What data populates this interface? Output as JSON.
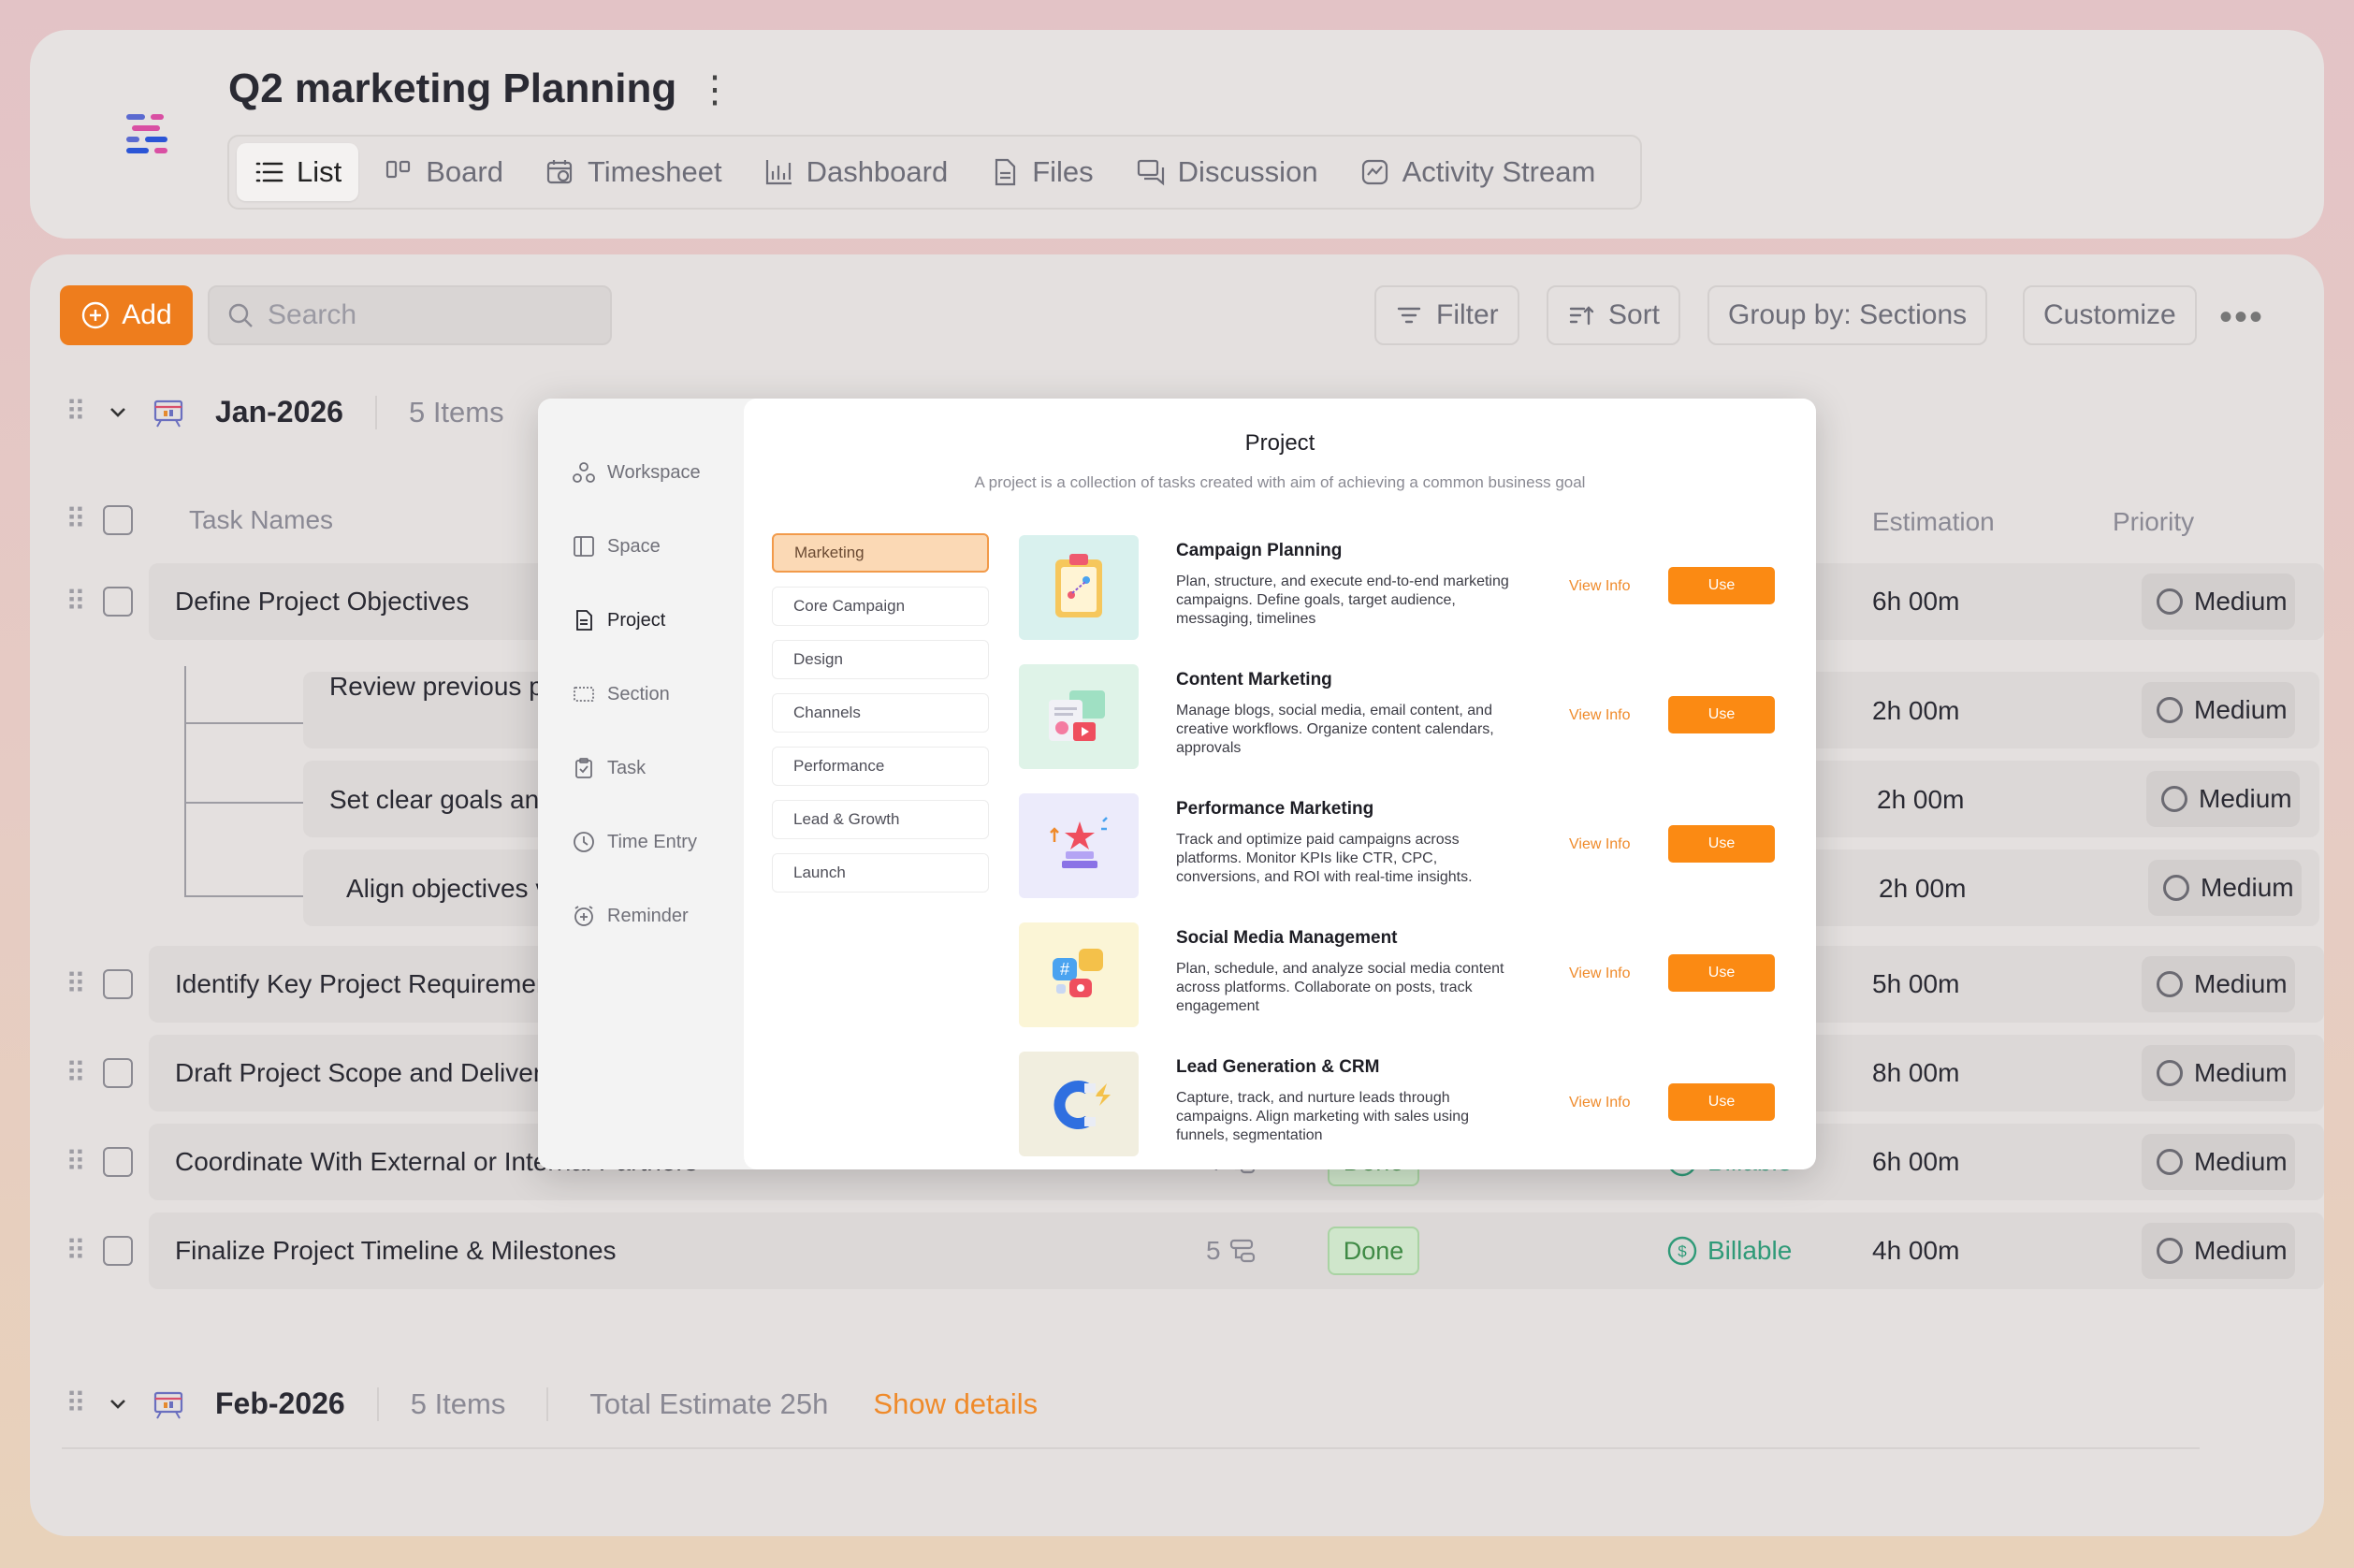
{
  "header": {
    "title": "Q2 marketing Planning",
    "tabs": [
      {
        "label": "List",
        "icon": "list-icon",
        "active": true
      },
      {
        "label": "Board",
        "icon": "board-icon"
      },
      {
        "label": "Timesheet",
        "icon": "timesheet-icon"
      },
      {
        "label": "Dashboard",
        "icon": "dashboard-icon"
      },
      {
        "label": "Files",
        "icon": "files-icon"
      },
      {
        "label": "Discussion",
        "icon": "discussion-icon"
      },
      {
        "label": "Activity Stream",
        "icon": "activity-icon"
      }
    ]
  },
  "toolbar": {
    "add_label": "Add",
    "search_placeholder": "Search",
    "filter_label": "Filter",
    "sort_label": "Sort",
    "group_label": "Group by: Sections",
    "customize_label": "Customize"
  },
  "groups": [
    {
      "name": "Jan-2026",
      "count": "5 Items"
    },
    {
      "name": "Feb-2026",
      "count": "5 Items",
      "total": "Total Estimate 25h",
      "show_details": "Show details"
    }
  ],
  "columns": {
    "task_names": "Task Names",
    "estimation": "Estimation",
    "priority": "Priority"
  },
  "tasks": [
    {
      "name": "Define Project Objectives",
      "estimate": "6h 00m",
      "priority": "Medium"
    },
    {
      "name": "Review previous pr",
      "estimate": "2h 00m",
      "priority": "Medium",
      "sub": true
    },
    {
      "name": "Set clear goals anc",
      "estimate": "2h 00m",
      "priority": "Medium",
      "sub": true
    },
    {
      "name": "Align objectives v",
      "estimate": "2h 00m",
      "priority": "Medium",
      "sub": true
    },
    {
      "name": "Identify Key Project Requirement",
      "estimate": "5h 00m",
      "priority": "Medium"
    },
    {
      "name": "Draft Project Scope and Delivera",
      "estimate": "8h 00m",
      "priority": "Medium"
    },
    {
      "name": "Coordinate With External or Internal Partners",
      "estimate": "6h 00m",
      "priority": "Medium",
      "count": "4",
      "status": "Done",
      "billing": "Billable"
    },
    {
      "name": "Finalize Project Timeline & Milestones",
      "estimate": "4h 00m",
      "priority": "Medium",
      "count": "5",
      "status": "Done",
      "billing": "Billable"
    }
  ],
  "modal": {
    "nav": [
      {
        "label": "Workspace",
        "icon": "workspace-icon"
      },
      {
        "label": "Space",
        "icon": "space-icon"
      },
      {
        "label": "Project",
        "icon": "project-icon",
        "active": true
      },
      {
        "label": "Section",
        "icon": "section-icon"
      },
      {
        "label": "Task",
        "icon": "task-icon"
      },
      {
        "label": "Time Entry",
        "icon": "time-entry-icon"
      },
      {
        "label": "Reminder",
        "icon": "reminder-icon"
      }
    ],
    "title": "Project",
    "subtitle": "A project is a collection of tasks created with aim of achieving a common business goal",
    "categories": [
      "Marketing",
      "Core Campaign",
      "Design",
      "Channels",
      "Performance",
      "Lead & Growth",
      "Launch"
    ],
    "templates": [
      {
        "name": "Campaign Planning",
        "desc": "Plan, structure, and execute end-to-end marketing campaigns. Define goals, target audience, messaging, timelines",
        "thumb": "#d9f1ee"
      },
      {
        "name": "Content Marketing",
        "desc": "Manage blogs, social media, email content, and creative workflows. Organize content calendars, approvals",
        "thumb": "#dff3e8"
      },
      {
        "name": "Performance Marketing",
        "desc": "Track and optimize paid campaigns across platforms. Monitor KPIs like CTR, CPC, conversions, and ROI with real-time insights.",
        "thumb": "#ecebfb"
      },
      {
        "name": "Social Media Management",
        "desc": "Plan, schedule, and analyze social media content across platforms. Collaborate on posts, track engagement",
        "thumb": "#fbf5d6"
      },
      {
        "name": "Lead Generation & CRM",
        "desc": "Capture, track, and nurture leads through campaigns. Align marketing with sales using funnels, segmentation",
        "thumb": "#f1eedf"
      }
    ],
    "view_info_label": "View Info",
    "use_label": "Use"
  },
  "colors": {
    "accent": "#ee7d1d",
    "use_button": "#fb8a13",
    "done_bg": "#cfe6cb",
    "billable": "#2f9a78"
  }
}
